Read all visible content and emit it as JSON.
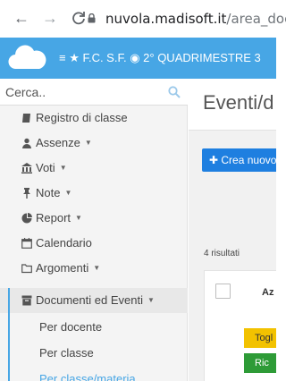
{
  "browser": {
    "back_icon": "←",
    "forward_icon": "→",
    "reload_icon": "C",
    "url_host": "nuvola.madisoft.it",
    "url_path": "/area_doce"
  },
  "topbar": {
    "menu_text": "≡ ★ F.C. S.F. ◉ 2° QUADRIMESTRE 3",
    "accent": "#47a6e5"
  },
  "sidebar": {
    "search_placeholder": "Cerca..",
    "items": [
      {
        "icon": "book-icon",
        "label": "Registro di classe",
        "caret": ""
      },
      {
        "icon": "user-icon",
        "label": "Assenze",
        "caret": "▼"
      },
      {
        "icon": "bank-icon",
        "label": "Voti",
        "caret": "▼"
      },
      {
        "icon": "pin-icon",
        "label": "Note",
        "caret": "▼"
      },
      {
        "icon": "pie-chart-icon",
        "label": "Report",
        "caret": "▼"
      },
      {
        "icon": "calendar-icon",
        "label": "Calendario",
        "caret": ""
      },
      {
        "icon": "folder-icon",
        "label": "Argomenti",
        "caret": "▼"
      },
      {
        "icon": "archive-icon",
        "label": "Documenti ed Eventi",
        "caret": "▼"
      }
    ],
    "sub_items": [
      "Per docente",
      "Per classe",
      "Per classe/materia"
    ]
  },
  "main": {
    "title": "Eventi/d",
    "new_button": "✚ Crea nuovo",
    "results": "4 risultati",
    "column_head": "Az",
    "tags": [
      "Togl",
      "Ric"
    ]
  }
}
